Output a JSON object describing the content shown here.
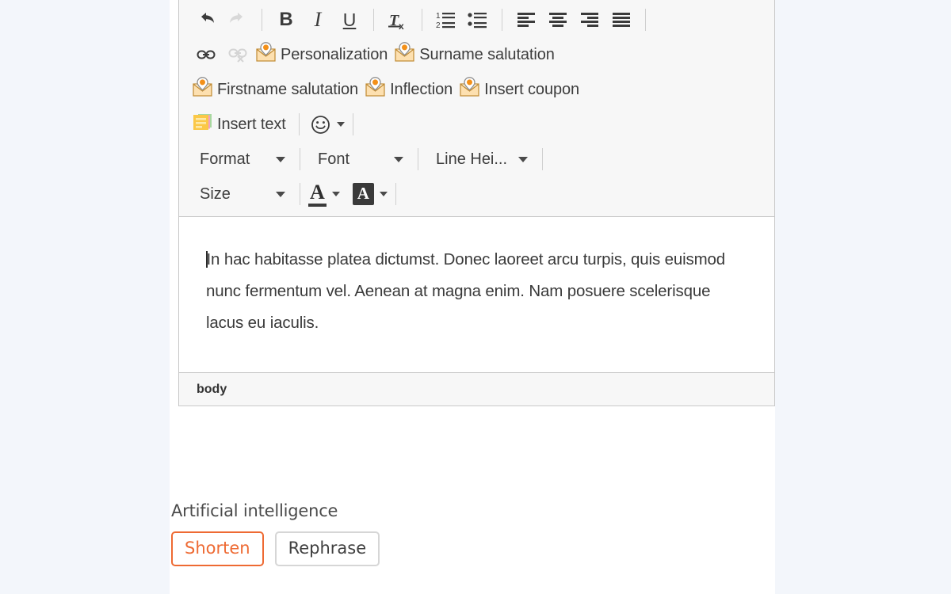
{
  "editor": {
    "toolbar": {
      "row1": [
        {
          "type": "icon",
          "name": "undo-icon",
          "title": "Undo",
          "disabled": false
        },
        {
          "type": "icon",
          "name": "redo-icon",
          "title": "Redo",
          "disabled": true
        },
        {
          "type": "sep"
        },
        {
          "type": "glyph",
          "name": "bold-icon",
          "glyph": "B",
          "style": "g-b",
          "title": "Bold"
        },
        {
          "type": "glyph",
          "name": "italic-icon",
          "glyph": "I",
          "style": "g-i",
          "title": "Italic"
        },
        {
          "type": "glyph",
          "name": "underline-icon",
          "glyph": "U",
          "style": "g-u",
          "title": "Underline"
        },
        {
          "type": "sep"
        },
        {
          "type": "icon",
          "name": "remove-format-icon",
          "title": "Remove Format",
          "disabled": false
        },
        {
          "type": "sep"
        },
        {
          "type": "icon",
          "name": "numbered-list-icon",
          "title": "Insert/Remove Numbered List",
          "disabled": false
        },
        {
          "type": "icon",
          "name": "bulleted-list-icon",
          "title": "Insert/Remove Bulleted List",
          "disabled": false
        },
        {
          "type": "sep"
        },
        {
          "type": "icon",
          "name": "align-left-icon",
          "title": "Align Left",
          "disabled": false
        },
        {
          "type": "icon",
          "name": "align-center-icon",
          "title": "Center",
          "disabled": false
        },
        {
          "type": "icon",
          "name": "align-right-icon",
          "title": "Align Right",
          "disabled": false
        },
        {
          "type": "icon",
          "name": "align-justify-icon",
          "title": "Justify",
          "disabled": false
        },
        {
          "type": "sep"
        }
      ],
      "row2": [
        {
          "type": "icon",
          "name": "link-icon",
          "title": "Link",
          "disabled": false
        },
        {
          "type": "icon",
          "name": "unlink-icon",
          "title": "Unlink",
          "disabled": true
        },
        {
          "type": "envelope",
          "name": "personalization-button",
          "label": "Personalization"
        },
        {
          "type": "envelope",
          "name": "surname-salutation-button",
          "label": "Surname salutation"
        }
      ],
      "row3": [
        {
          "type": "envelope",
          "name": "firstname-salutation-button",
          "label": "Firstname salutation"
        },
        {
          "type": "envelope",
          "name": "inflection-button",
          "label": "Inflection"
        },
        {
          "type": "envelope",
          "name": "insert-coupon-button",
          "label": "Insert coupon"
        }
      ],
      "row4": [
        {
          "type": "note",
          "name": "insert-text-button",
          "label": "Insert text"
        },
        {
          "type": "sep"
        },
        {
          "type": "emoji",
          "name": "emoticon-button",
          "glyph": "☺"
        },
        {
          "type": "sep"
        }
      ],
      "row5": [
        {
          "type": "dropdown",
          "name": "format-select",
          "label": "Format"
        },
        {
          "type": "sep"
        },
        {
          "type": "dropdown",
          "name": "font-select",
          "label": "Font"
        },
        {
          "type": "sep"
        },
        {
          "type": "dropdown",
          "name": "line-height-select",
          "label": "Line Hei..."
        },
        {
          "type": "sep"
        }
      ],
      "row6": [
        {
          "type": "dropdown",
          "name": "size-select",
          "label": "Size"
        },
        {
          "type": "sep"
        },
        {
          "type": "textcolor",
          "name": "text-color-button",
          "glyph": "A"
        },
        {
          "type": "bgcolor",
          "name": "background-color-button",
          "glyph": "A"
        },
        {
          "type": "sep"
        }
      ]
    },
    "content": {
      "paragraph": "In hac habitasse platea dictumst. Donec laoreet arcu turpis, quis euismod nunc fermentum vel. Aenean at magna enim. Nam posuere scelerisque lacus eu iaculis."
    },
    "path": {
      "element": "body"
    }
  },
  "ai": {
    "title": "Artificial intelligence",
    "buttons": [
      {
        "name": "shorten-button",
        "label": "Shorten",
        "variant": "primary"
      },
      {
        "name": "rephrase-button",
        "label": "Rephrase",
        "variant": "secondary"
      }
    ]
  },
  "colors": {
    "accent_orange": "#ee6a33",
    "page_background": "#f3f6fb",
    "toolbar_background": "#f7f7f7",
    "border": "#c8c8c8",
    "text": "#3a3a3a"
  }
}
